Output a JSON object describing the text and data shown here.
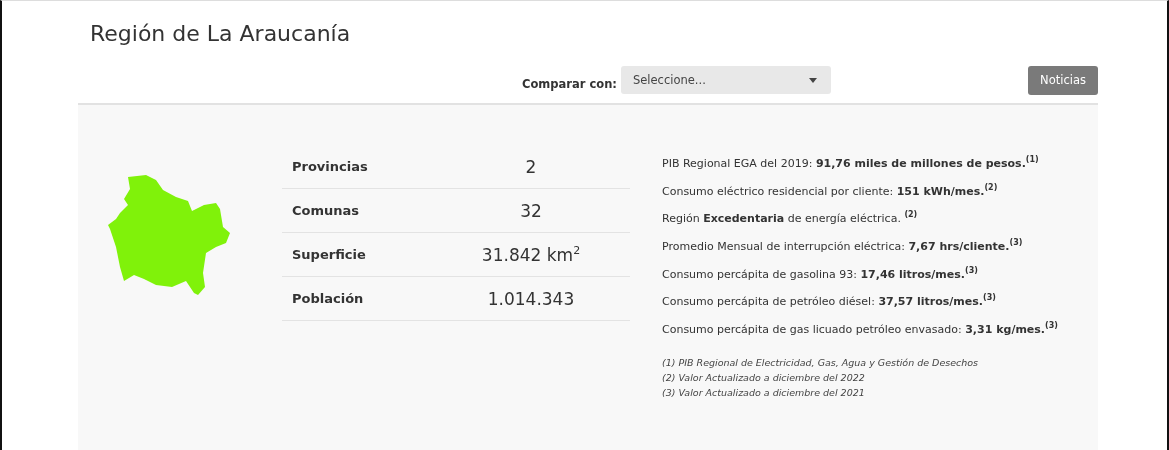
{
  "title": "Región de La Araucanía",
  "compare": {
    "label": "Comparar con:",
    "placeholder": "Seleccione..."
  },
  "news_button": "Noticias",
  "stats": [
    {
      "label": "Provincias",
      "value": "2"
    },
    {
      "label": "Comunas",
      "value": "32"
    },
    {
      "label": "Superficie",
      "value": "31.842 km$^{2}$"
    },
    {
      "label": "Población",
      "value": "1.014.343"
    }
  ],
  "facts": [
    "PIB Regional EGA del 2019: **91,76 miles de millones de pesos.**$^{(1)}$",
    "Consumo eléctrico residencial por cliente: **151 kWh/mes.**$^{(2)}$",
    "Región **Excedentaria** de energía eléctrica. $^{(2)}$",
    "Promedio Mensual de interrupción eléctrica: **7,67 hrs/cliente.**$^{(3)}$",
    "Consumo percápita de gasolina 93: **17,46 litros/mes.**$^{(3)}$",
    "Consumo percápita de petróleo diésel: **37,57 litros/mes.**$^{(3)}$",
    "Consumo percápita de gas licuado petróleo envasado: **3,31 kg/mes.**$^{(3)}$"
  ],
  "notes": [
    "(1) PIB Regional de Electricidad, Gas, Agua y Gestión de Desechos",
    "(2) Valor Actualizado a diciembre del 2022",
    "(3) Valor Actualizado a diciembre del 2021"
  ]
}
